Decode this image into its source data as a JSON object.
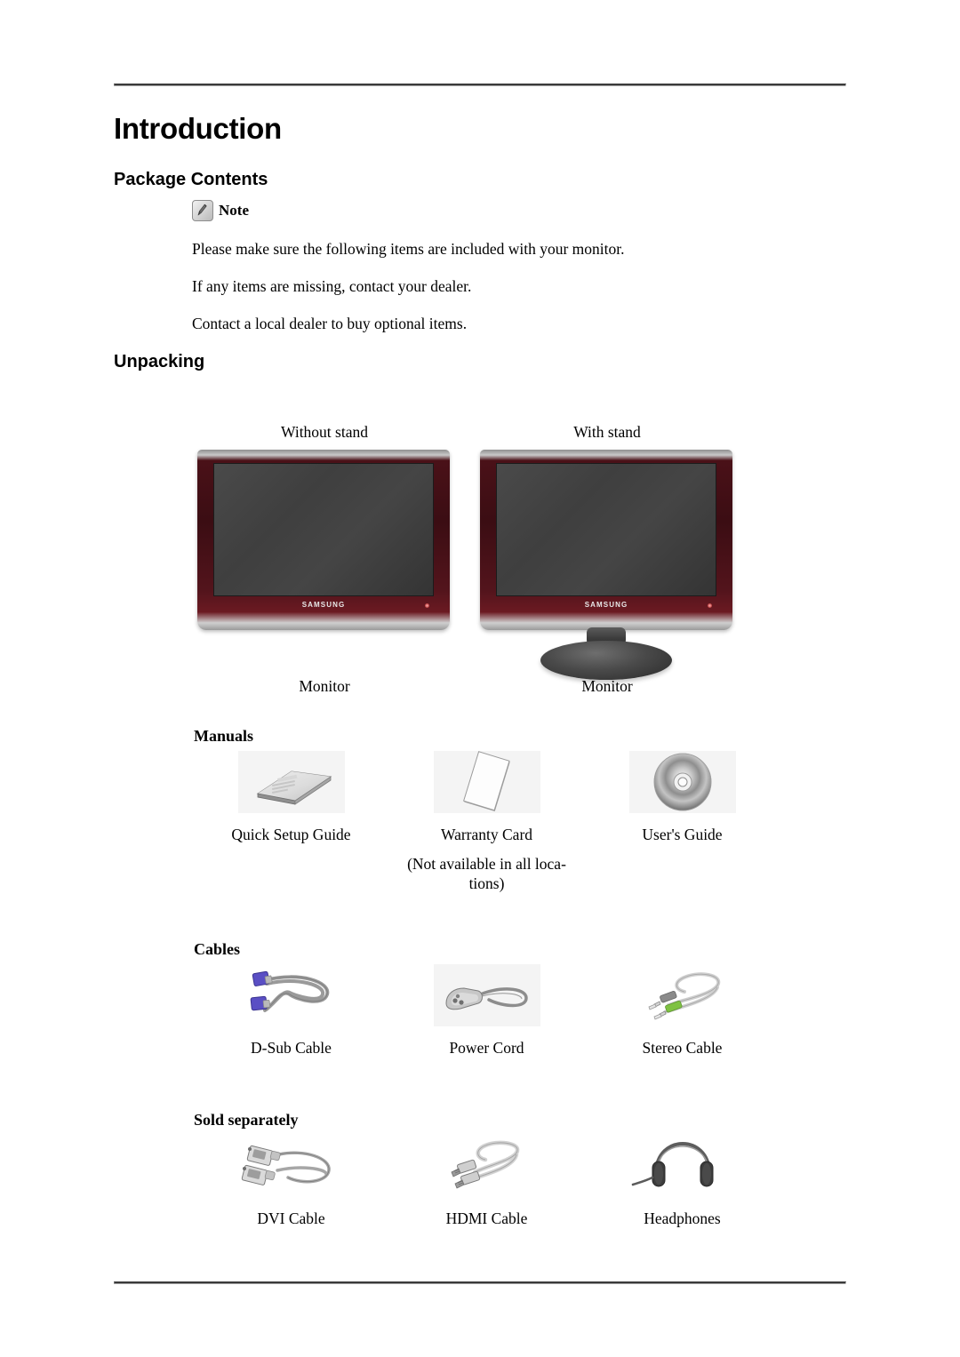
{
  "document": {
    "title": "Introduction",
    "sections": {
      "package_contents": {
        "heading": "Package Contents",
        "note_label": "Note",
        "note_icon": "note-pen-icon",
        "paragraphs": [
          "Please make sure the following items are included with your monitor.",
          "If any items are missing, contact your dealer.",
          "Contact a local dealer to buy optional items."
        ]
      },
      "unpacking": {
        "heading": "Unpacking",
        "monitors": [
          {
            "variant_label": "Without stand",
            "caption": "Monitor",
            "brand": "SAMSUNG",
            "has_stand": false
          },
          {
            "variant_label": "With stand",
            "caption": "Monitor",
            "brand": "SAMSUNG",
            "has_stand": true
          }
        ],
        "groups": [
          {
            "label": "Manuals",
            "items": [
              {
                "caption": "Quick Setup Guide",
                "note": "",
                "icon": "booklet-icon"
              },
              {
                "caption": "Warranty Card",
                "note": "(Not available in all loca-\ntions)",
                "icon": "card-icon"
              },
              {
                "caption": "User's Guide",
                "note": "",
                "icon": "cd-disc-icon"
              }
            ]
          },
          {
            "label": "Cables",
            "items": [
              {
                "caption": "D-Sub Cable",
                "note": "",
                "icon": "dsub-cable-icon"
              },
              {
                "caption": "Power Cord",
                "note": "",
                "icon": "power-cord-icon"
              },
              {
                "caption": "Stereo Cable",
                "note": "",
                "icon": "stereo-cable-icon"
              }
            ]
          },
          {
            "label": "Sold separately",
            "items": [
              {
                "caption": "DVI Cable",
                "note": "",
                "icon": "dvi-cable-icon"
              },
              {
                "caption": "HDMI Cable",
                "note": "",
                "icon": "hdmi-cable-icon"
              },
              {
                "caption": "Headphones",
                "note": "",
                "icon": "headphones-icon"
              }
            ]
          }
        ]
      }
    },
    "colors": {
      "bezel_red": "#3b0d13",
      "bezel_silver": "#c9c9c9",
      "screen_gray": "#434343",
      "dsub_connector_blue": "#5a4fc4",
      "stereo_connector_green": "#7fc242",
      "stereo_connector_gray": "#8a8a8a",
      "rule_gray": "#3a3a3a"
    }
  }
}
